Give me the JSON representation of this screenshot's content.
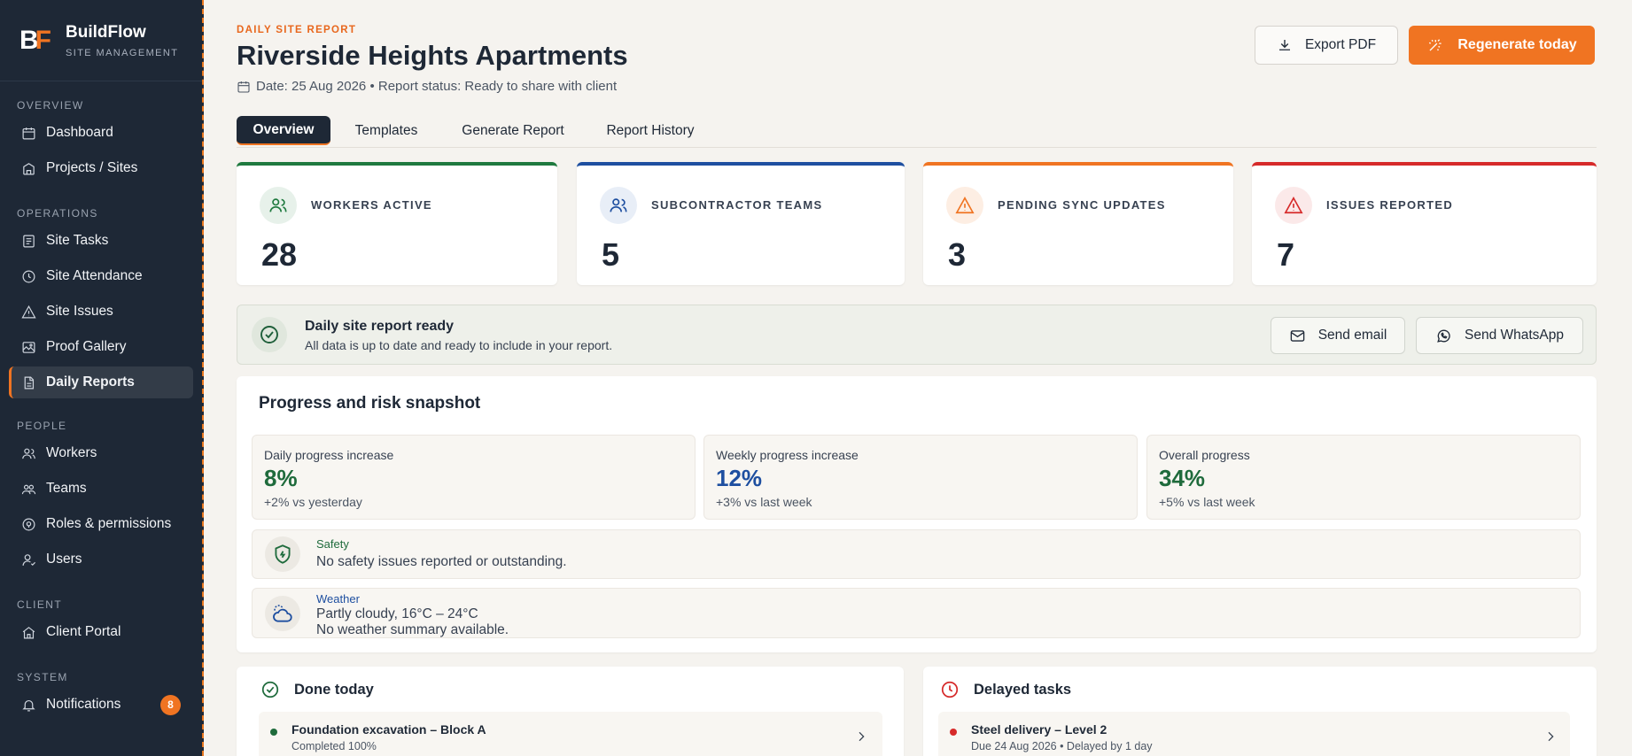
{
  "app": {
    "logo_b": "B",
    "logo_f": "F",
    "name": "BuildFlow",
    "subtitle": "SITE MANAGEMENT"
  },
  "sidebar": {
    "sections": [
      {
        "title": "OVERVIEW",
        "items": [
          {
            "label": "Dashboard",
            "icon": "calendar-icon"
          },
          {
            "label": "Projects / Sites",
            "icon": "building-icon"
          }
        ]
      },
      {
        "title": "OPERATIONS",
        "items": [
          {
            "label": "Site Tasks",
            "icon": "list-icon"
          },
          {
            "label": "Site Attendance",
            "icon": "clock-icon"
          },
          {
            "label": "Site Issues",
            "icon": "warning-icon"
          },
          {
            "label": "Proof Gallery",
            "icon": "gallery-icon"
          },
          {
            "label": "Daily Reports",
            "icon": "document-icon",
            "active": true
          }
        ]
      },
      {
        "title": "PEOPLE",
        "items": [
          {
            "label": "Workers",
            "icon": "users-icon"
          },
          {
            "label": "Teams",
            "icon": "team-icon"
          },
          {
            "label": "Roles & permissions",
            "icon": "shield-icon"
          },
          {
            "label": "Users",
            "icon": "user-icon"
          }
        ]
      },
      {
        "title": "CLIENT",
        "items": [
          {
            "label": "Client Portal",
            "icon": "home-icon"
          }
        ]
      },
      {
        "title": "SYSTEM",
        "items": [
          {
            "label": "Notifications",
            "icon": "bell-icon",
            "badge": "8"
          }
        ]
      }
    ]
  },
  "header": {
    "eyebrow": "DAILY SITE REPORT",
    "title": "Riverside Heights Apartments",
    "meta": "Date: 25 Aug 2026 • Report status: Ready to share with client",
    "export_label": "Export PDF",
    "regenerate_label": "Regenerate today"
  },
  "tabs": [
    {
      "label": "Overview",
      "active": true
    },
    {
      "label": "Templates"
    },
    {
      "label": "Generate Report"
    },
    {
      "label": "Report History"
    }
  ],
  "stats": [
    {
      "label": "WORKERS ACTIVE",
      "value": "28",
      "color": "#1f7a3f",
      "icon": "users-icon"
    },
    {
      "label": "SUBCONTRACTOR TEAMS",
      "value": "5",
      "color": "#1e4fa0",
      "icon": "team-icon"
    },
    {
      "label": "PENDING SYNC UPDATES",
      "value": "3",
      "color": "#f07422",
      "icon": "warning-icon"
    },
    {
      "label": "ISSUES REPORTED",
      "value": "7",
      "color": "#d62a2a",
      "icon": "alert-icon"
    }
  ],
  "ready": {
    "title": "Daily site report ready",
    "subtitle": "All data is up to date and ready to include in your report.",
    "email_label": "Send email",
    "whatsapp_label": "Send WhatsApp"
  },
  "progress": {
    "title": "Progress and risk snapshot",
    "metrics": [
      {
        "label": "Daily progress increase",
        "value": "8%",
        "delta": "+2% vs yesterday",
        "color": "#1f6b3c"
      },
      {
        "label": "Weekly progress increase",
        "value": "12%",
        "delta": "+3% vs last week",
        "color": "#1e4fa0"
      },
      {
        "label": "Overall progress",
        "value": "34%",
        "delta": "+5% vs last week",
        "color": "#1f6b3c"
      }
    ],
    "safety": {
      "label": "Safety",
      "text": "No safety issues reported or outstanding."
    },
    "weather": {
      "label": "Weather",
      "line1": "Partly cloudy, 16°C – 24°C",
      "line2": "No weather summary available."
    }
  },
  "done_today": {
    "title": "Done today",
    "items": [
      {
        "title": "Foundation excavation – Block A",
        "sub": "Completed 100%"
      }
    ]
  },
  "delayed": {
    "title": "Delayed tasks",
    "items": [
      {
        "title": "Steel delivery – Level 2",
        "sub": "Due 24 Aug 2026 • Delayed by 1 day"
      }
    ]
  },
  "colors": {
    "accent": "#f07422",
    "sidebar_bg": "#1e2836",
    "success": "#1f6b3c",
    "danger": "#d62a2a",
    "info": "#1e4fa0"
  }
}
